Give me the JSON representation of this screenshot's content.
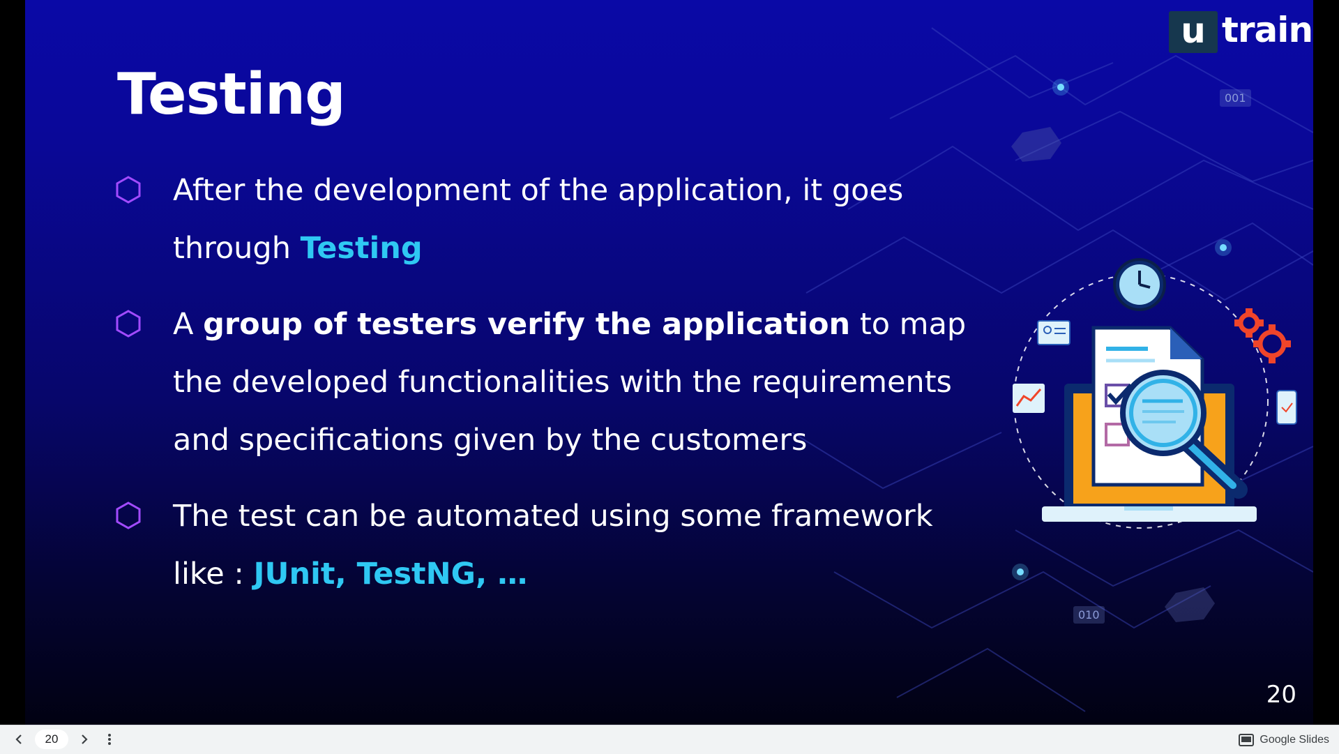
{
  "slide": {
    "title": "Testing",
    "bullets": [
      {
        "parts": [
          {
            "text": "After the development of the application, it goes through ",
            "style": "normal"
          },
          {
            "text": "Testing",
            "style": "highlight"
          }
        ]
      },
      {
        "parts": [
          {
            "text": "A ",
            "style": "normal"
          },
          {
            "text": "group of testers verify the application",
            "style": "bold"
          },
          {
            "text": " to map the developed functionalities with the requirements and specifications given by the customers",
            "style": "normal"
          }
        ]
      },
      {
        "parts": [
          {
            "text": "The test can be automated using some framework like : ",
            "style": "normal"
          },
          {
            "text": "JUnit, TestNG, …",
            "style": "highlight"
          }
        ]
      }
    ],
    "slide_number": "20",
    "logo": {
      "u": "u",
      "train": "train"
    },
    "binary_tags": [
      "001",
      "010"
    ],
    "colors": {
      "accent": "#2fc8f3",
      "bullet_marker": "#a24bff",
      "bg_top": "#0a09a6",
      "bg_bottom": "#010112"
    }
  },
  "toolbar": {
    "prev_icon": "chevron-left-icon",
    "page": "20",
    "next_icon": "chevron-right-icon",
    "menu_icon": "more-vert-icon",
    "brand": "Google Slides"
  }
}
